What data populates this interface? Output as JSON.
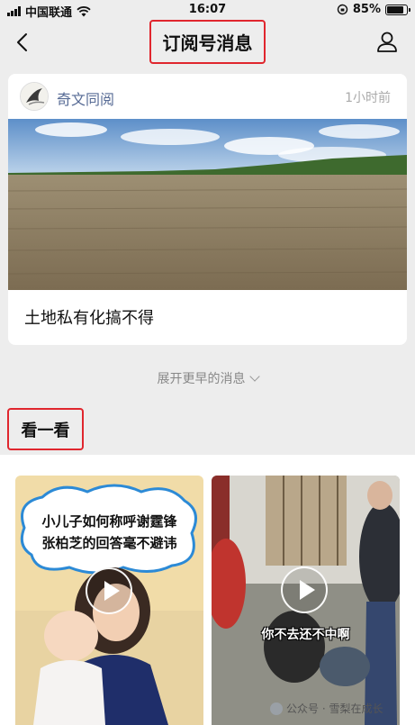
{
  "status_bar": {
    "carrier": "中国联通",
    "time": "16:07",
    "battery": "85%",
    "battery_level": 0.85
  },
  "nav": {
    "title": "订阅号消息",
    "back_icon": "chevron-left-icon",
    "profile_icon": "person-icon"
  },
  "message": {
    "account_name": "奇文同阅",
    "time": "1小时前",
    "article_title": "土地私有化搞不得"
  },
  "expand_label": "展开更早的消息",
  "look_section": {
    "heading": "看一看",
    "videos": [
      {
        "line1": "小儿子如何称呼谢霆锋",
        "line2": "张柏芝的回答毫不避讳"
      },
      {
        "caption": "你不去还不中啊"
      }
    ]
  },
  "watermark": "公众号 · 雪梨在成长",
  "colors": {
    "highlight_box": "#e0262e",
    "account_name": "#576b95",
    "background": "#ededed"
  }
}
